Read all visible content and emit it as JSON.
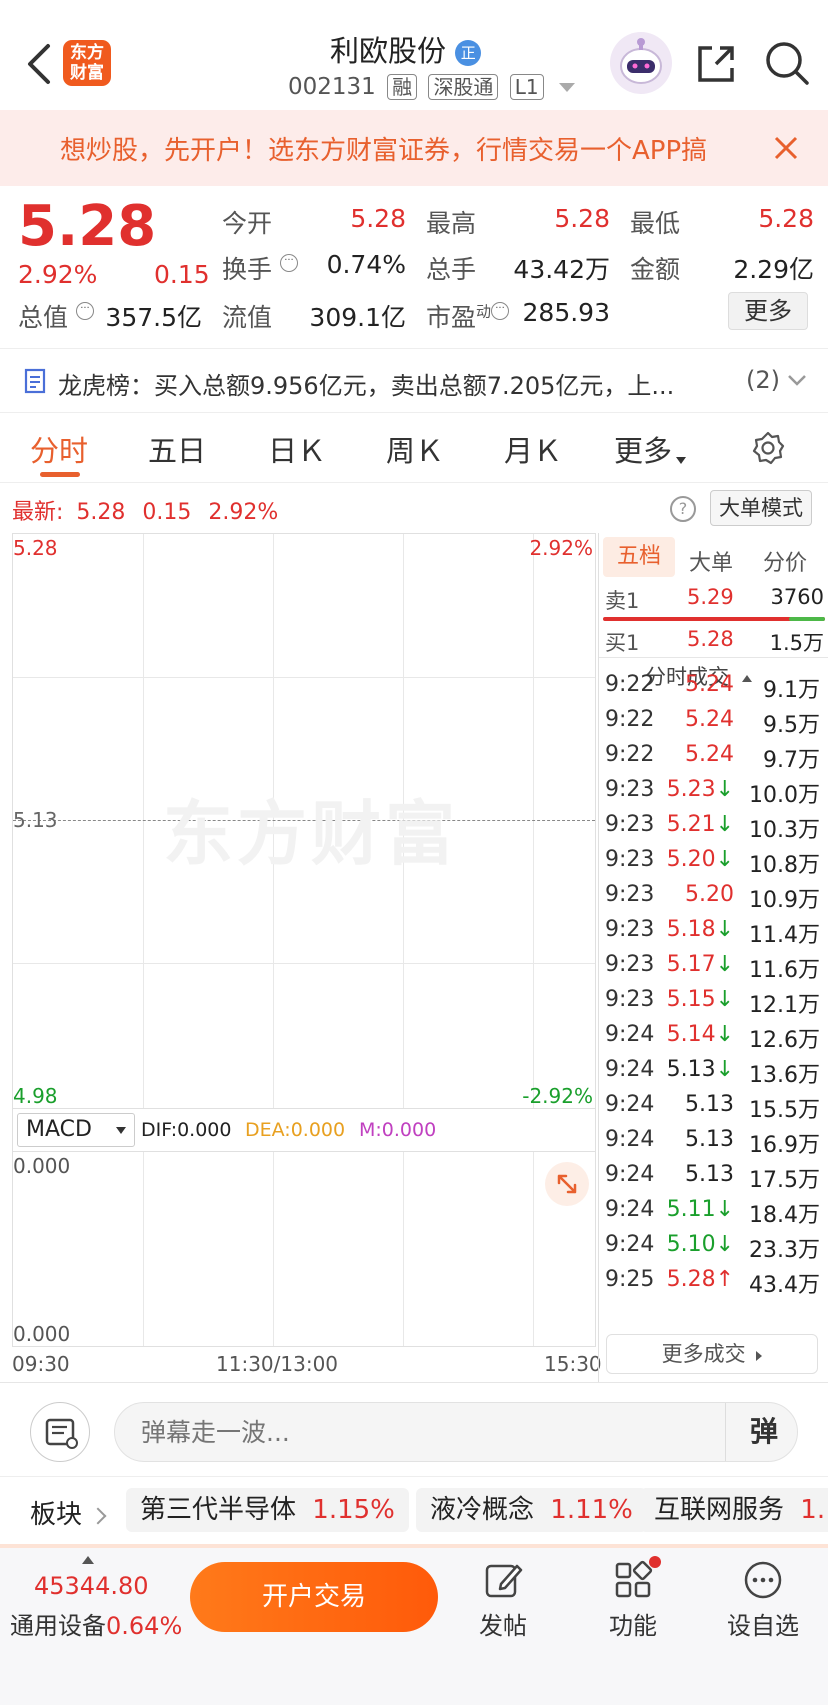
{
  "header": {
    "app_logo_text": [
      "东方",
      "财富"
    ],
    "stock_name": "利欧股份",
    "stock_code": "002131",
    "tags": [
      "融",
      "深股通",
      "L1"
    ],
    "badge": "正"
  },
  "banner": {
    "text": "想炒股，先开户！选东方财富证券，行情交易一个APP搞"
  },
  "quote": {
    "price": "5.28",
    "change_pct": "2.92%",
    "change_amt": "0.15",
    "open_label": "今开",
    "open": "5.28",
    "high_label": "最高",
    "high": "5.28",
    "low_label": "最低",
    "low": "5.28",
    "turnover_label": "换手",
    "turnover": "0.74%",
    "volume_label": "总手",
    "volume": "43.42万",
    "amount_label": "金额",
    "amount": "2.29亿",
    "mcap_label": "总值",
    "mcap": "357.5亿",
    "float_label": "流值",
    "float": "309.1亿",
    "pe_label": "市盈",
    "pe_sup": "动",
    "pe": "285.93",
    "more_label": "更多"
  },
  "dragon_tiger": {
    "text": "龙虎榜：买入总额9.956亿元，卖出总额7.205亿元，上...",
    "count": "(2)"
  },
  "tabs": [
    {
      "label": "分时",
      "active": true
    },
    {
      "label": "五日"
    },
    {
      "label": "日Ｋ"
    },
    {
      "label": "周Ｋ"
    },
    {
      "label": "月Ｋ"
    },
    {
      "label": "更多"
    }
  ],
  "chart_info": {
    "latest_label": "最新:",
    "latest_price": "5.28",
    "latest_change": "0.15",
    "latest_pct": "2.92%",
    "big_order_mode": "大单模式",
    "watermark": "东方财富",
    "y_top": "5.28",
    "y_mid": "5.13",
    "y_bottom": "4.98",
    "pct_top": "2.92%",
    "pct_bottom": "-2.92%",
    "x_start": "09:30",
    "x_mid": "11:30/13:00",
    "x_end": "15:30"
  },
  "macd": {
    "label": "MACD",
    "dif": "DIF:0.000",
    "dea": "DEA:0.000",
    "m": "M:0.000",
    "y_top": "0.000",
    "y_bottom": "0.000"
  },
  "order_book": {
    "tabs": [
      "五档",
      "大单",
      "分价"
    ],
    "sell1_label": "卖1",
    "sell1_price": "5.29",
    "sell1_vol": "3760",
    "buy1_label": "买1",
    "buy1_price": "5.28",
    "buy1_vol": "1.5万",
    "trades_title": "分时成交",
    "more_trades": "更多成交"
  },
  "trades": [
    {
      "time": "9:22",
      "price": "5.24",
      "amt": "9.1万",
      "color": "red",
      "arrow": ""
    },
    {
      "time": "9:22",
      "price": "5.24",
      "amt": "9.5万",
      "color": "red",
      "arrow": ""
    },
    {
      "time": "9:22",
      "price": "5.24",
      "amt": "9.7万",
      "color": "red",
      "arrow": ""
    },
    {
      "time": "9:23",
      "price": "5.23",
      "amt": "10.0万",
      "color": "red",
      "arrow": "↓"
    },
    {
      "time": "9:23",
      "price": "5.21",
      "amt": "10.3万",
      "color": "red",
      "arrow": "↓"
    },
    {
      "time": "9:23",
      "price": "5.20",
      "amt": "10.8万",
      "color": "red",
      "arrow": "↓"
    },
    {
      "time": "9:23",
      "price": "5.20",
      "amt": "10.9万",
      "color": "red",
      "arrow": ""
    },
    {
      "time": "9:23",
      "price": "5.18",
      "amt": "11.4万",
      "color": "red",
      "arrow": "↓"
    },
    {
      "time": "9:23",
      "price": "5.17",
      "amt": "11.6万",
      "color": "red",
      "arrow": "↓"
    },
    {
      "time": "9:23",
      "price": "5.15",
      "amt": "12.1万",
      "color": "red",
      "arrow": "↓"
    },
    {
      "time": "9:24",
      "price": "5.14",
      "amt": "12.6万",
      "color": "red",
      "arrow": "↓"
    },
    {
      "time": "9:24",
      "price": "5.13",
      "amt": "13.6万",
      "color": "black",
      "arrow": "↓"
    },
    {
      "time": "9:24",
      "price": "5.13",
      "amt": "15.5万",
      "color": "black",
      "arrow": ""
    },
    {
      "time": "9:24",
      "price": "5.13",
      "amt": "16.9万",
      "color": "black",
      "arrow": ""
    },
    {
      "time": "9:24",
      "price": "5.13",
      "amt": "17.5万",
      "color": "black",
      "arrow": ""
    },
    {
      "time": "9:24",
      "price": "5.11",
      "amt": "18.4万",
      "color": "green",
      "arrow": "↓"
    },
    {
      "time": "9:24",
      "price": "5.10",
      "amt": "23.3万",
      "color": "green",
      "arrow": "↓"
    },
    {
      "time": "9:25",
      "price": "5.28",
      "amt": "43.4万",
      "color": "red",
      "arrow": "↑"
    }
  ],
  "comment": {
    "placeholder": "弹幕走一波...",
    "danmaku_label": "弹"
  },
  "sectors": {
    "label": "板块",
    "items": [
      {
        "name": "第三代半导体",
        "pct": "1.15%"
      },
      {
        "name": "液冷概念",
        "pct": "1.11%"
      },
      {
        "name": "互联网服务",
        "pct": "1."
      }
    ]
  },
  "bottom": {
    "index_value": "45344.80",
    "index_name": "通用设备",
    "index_pct": "0.64%",
    "trade_button": "开户交易",
    "post_label": "发帖",
    "func_label": "功能",
    "watch_label": "设自选"
  },
  "colors": {
    "up": "#e0302e",
    "down": "#1a9f2c",
    "accent": "#ff6a13",
    "banner_bg": "#fdecea"
  }
}
